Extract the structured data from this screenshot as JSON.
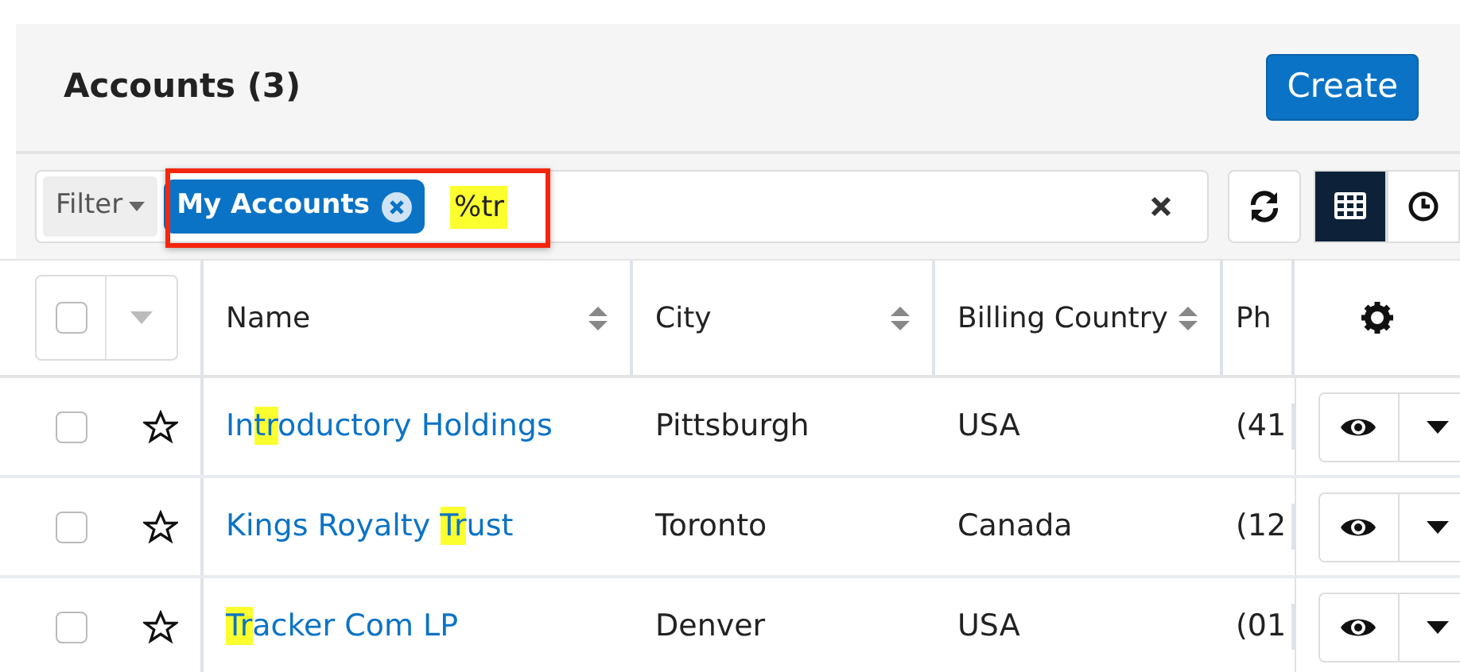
{
  "header": {
    "title": "Accounts (3)",
    "create_button": "Create"
  },
  "filter": {
    "label": "Filter",
    "pill": "My Accounts",
    "search_value": "%tr",
    "search_highlight": true,
    "annotation_frame": true
  },
  "select_all": {
    "checked": false
  },
  "view_toggle": [
    {
      "kind": "list",
      "selected": true
    },
    {
      "kind": "activity",
      "selected": false
    }
  ],
  "table": {
    "columns": [
      "Name",
      "City",
      "Billing Country",
      "Ph"
    ],
    "rows": [
      {
        "checked": false,
        "favorite": false,
        "name": [
          {
            "text": "In",
            "highlight": false
          },
          {
            "text": "tr",
            "highlight": true
          },
          {
            "text": "oductory Holdings",
            "highlight": false
          }
        ],
        "city": "Pittsburgh",
        "country": "USA",
        "column_4": "(41"
      },
      {
        "checked": false,
        "favorite": false,
        "name": [
          {
            "text": "Kings Royalty ",
            "highlight": false
          },
          {
            "text": "Tr",
            "highlight": true
          },
          {
            "text": "ust",
            "highlight": false
          }
        ],
        "city": "Toronto",
        "country": "Canada",
        "column_4": "(12"
      },
      {
        "checked": false,
        "favorite": false,
        "name": [
          {
            "text": "Tr",
            "highlight": true
          },
          {
            "text": "acker Com LP",
            "highlight": false
          }
        ],
        "city": "Denver",
        "country": "USA",
        "column_4": "(01"
      }
    ]
  }
}
